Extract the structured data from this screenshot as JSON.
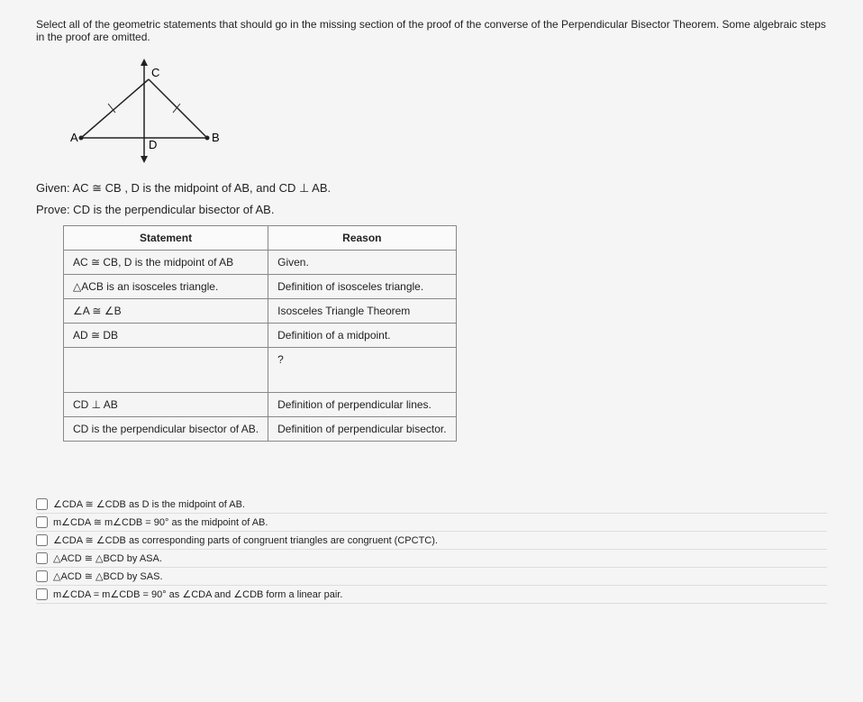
{
  "question": "Select all of the geometric statements that should go in the missing section of the proof of the converse of the Perpendicular Bisector Theorem. Some algebraic steps in the proof are omitted.",
  "diagram": {
    "labelA": "A",
    "labelB": "B",
    "labelC": "C",
    "labelD": "D"
  },
  "given": "Given: AC ≅ CB , D is the midpoint of AB, and CD ⊥ AB.",
  "prove": "Prove: CD is the perpendicular bisector of AB.",
  "table": {
    "headers": {
      "stmt": "Statement",
      "reason": "Reason"
    },
    "rows": [
      {
        "stmt": "AC ≅ CB, D is the midpoint of AB",
        "reason": "Given."
      },
      {
        "stmt": "△ACB is an isosceles triangle.",
        "reason": "Definition of isosceles triangle."
      },
      {
        "stmt": "∠A ≅ ∠B",
        "reason": "Isosceles Triangle Theorem"
      },
      {
        "stmt": "AD ≅ DB",
        "reason": "Definition of a midpoint."
      },
      {
        "stmt": "",
        "reason": "?"
      },
      {
        "stmt": "CD ⊥ AB",
        "reason": "Definition of perpendicular lines."
      },
      {
        "stmt": "CD is the perpendicular bisector of AB.",
        "reason": "Definition of perpendicular bisector."
      }
    ]
  },
  "options": [
    "∠CDA ≅ ∠CDB as D is the midpoint of AB.",
    "m∠CDA ≅ m∠CDB = 90° as the midpoint of AB.",
    "∠CDA ≅ ∠CDB as corresponding parts of congruent triangles are congruent (CPCTC).",
    "△ACD ≅ △BCD by ASA.",
    "△ACD ≅ △BCD by SAS.",
    "m∠CDA = m∠CDB = 90° as ∠CDA and ∠CDB form a linear pair."
  ]
}
